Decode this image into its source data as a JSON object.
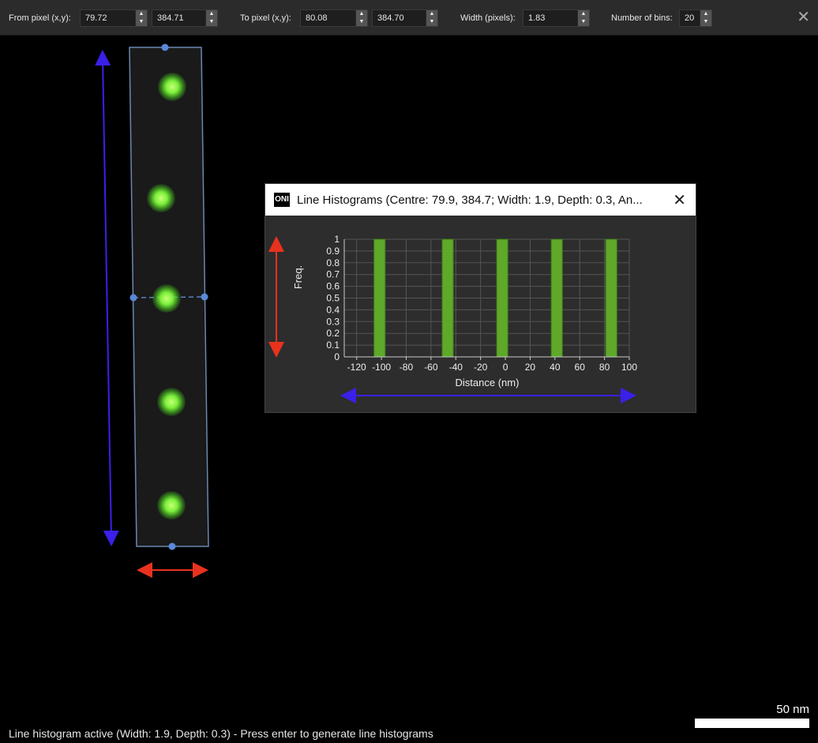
{
  "toolbar": {
    "from_label": "From pixel (x,y):",
    "from_x": "79.72",
    "from_y": "384.71",
    "to_label": "To pixel (x,y):",
    "to_x": "80.08",
    "to_y": "384.70",
    "width_label": "Width (pixels):",
    "width_value": "1.83",
    "bins_label": "Number of bins:",
    "bins_value": "20"
  },
  "histogram": {
    "logo": "ONI",
    "title": "Line Histograms (Centre: 79.9, 384.7; Width: 1.9, Depth: 0.3, An...",
    "accent_bar": "#5ea82a",
    "arrow_red": "#e8321e",
    "arrow_blue": "#3a20e8"
  },
  "chart_data": {
    "type": "bar",
    "xlabel": "Distance (nm)",
    "ylabel": "Freq.",
    "xlim": [
      -130,
      100
    ],
    "ylim": [
      0,
      1
    ],
    "x_ticks": [
      -120,
      -100,
      -80,
      -60,
      -40,
      -20,
      0,
      20,
      40,
      60,
      80,
      100
    ],
    "y_ticks": [
      0,
      0.1,
      0.2,
      0.3,
      0.4,
      0.5,
      0.6,
      0.7,
      0.8,
      0.9,
      1
    ],
    "bars": [
      {
        "x0": -106,
        "x1": -97,
        "value": 1
      },
      {
        "x0": -51,
        "x1": -42,
        "value": 1
      },
      {
        "x0": -7,
        "x1": 2,
        "value": 1
      },
      {
        "x0": 37,
        "x1": 46,
        "value": 1
      },
      {
        "x0": 81,
        "x1": 90,
        "value": 1
      }
    ],
    "grid": true
  },
  "status": "Line histogram active (Width: 1.9, Depth: 0.3) - Press enter to generate line histograms",
  "scale_bar": "50 nm"
}
